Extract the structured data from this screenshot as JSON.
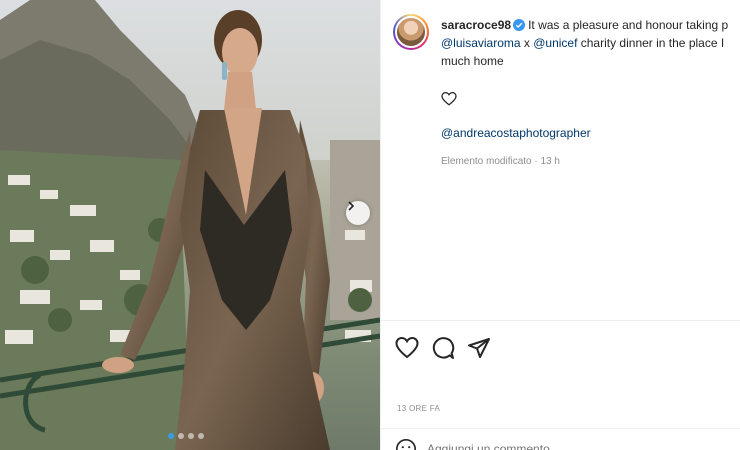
{
  "post": {
    "username": "saracroce98",
    "caption_text_1": "It was a pleasure and honour taking p",
    "mention_1": "@luisaviaroma",
    "caption_x": " x ",
    "mention_2": "@unicef",
    "caption_text_2": " charity dinner in the place I",
    "caption_text_3": "much home",
    "photographer_mention": "@andreacostaphotographer",
    "edited_label": "Elemento modificato · 13 h",
    "timestamp": "13 ORE FA",
    "comment_placeholder": "Aggiungi un commento..."
  },
  "icons": {
    "verified": "verified-badge-icon",
    "like": "heart-icon",
    "comment": "comment-icon",
    "share": "share-icon",
    "next": "chevron-right-icon",
    "emoji": "emoji-icon"
  },
  "carousel": {
    "slide_count": 4,
    "active_index": 0
  },
  "colors": {
    "link": "#00376b",
    "verified": "#3897f0",
    "muted": "#8e8e8e",
    "active_dot": "#3e9ae6"
  }
}
